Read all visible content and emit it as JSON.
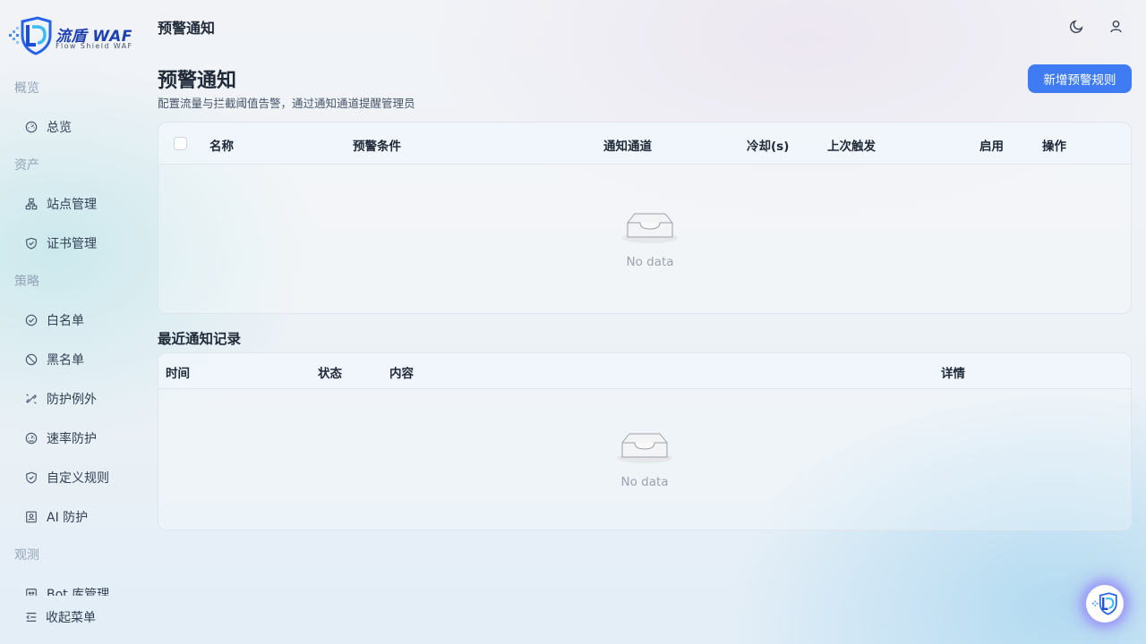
{
  "app": {
    "logo_title": "流盾 WAF",
    "logo_subtitle": "Flow Shield WAF",
    "brand_color": "#1e40af",
    "accent_color": "#3f7cf4"
  },
  "header": {
    "title": "预警通知",
    "theme_icon": "moon-icon",
    "user_icon": "user-icon"
  },
  "sidebar": {
    "groups": [
      {
        "label": "概览",
        "items": [
          {
            "label": "总览",
            "icon": "dashboard-icon"
          }
        ]
      },
      {
        "label": "资产",
        "items": [
          {
            "label": "站点管理",
            "icon": "sitemap-icon"
          },
          {
            "label": "证书管理",
            "icon": "shield-check-icon"
          }
        ]
      },
      {
        "label": "策略",
        "items": [
          {
            "label": "白名单",
            "icon": "check-circle-icon"
          },
          {
            "label": "黑名单",
            "icon": "ban-icon"
          },
          {
            "label": "防护例外",
            "icon": "unlink-icon"
          },
          {
            "label": "速率防护",
            "icon": "speedometer-icon"
          },
          {
            "label": "自定义规则",
            "icon": "shield-check-icon"
          },
          {
            "label": "AI 防护",
            "icon": "robot-icon"
          }
        ]
      },
      {
        "label": "观测",
        "items": [
          {
            "label": "Bot 库管理",
            "icon": "bot-icon"
          }
        ]
      }
    ],
    "collapse_label": "收起菜单"
  },
  "page": {
    "title": "预警通知",
    "description": "配置流量与拦截阈值告警，通过通知通道提醒管理员",
    "add_button": "新增预警规则"
  },
  "rules_table": {
    "columns": [
      "名称",
      "预警条件",
      "通知通道",
      "冷却(s)",
      "上次触发",
      "启用",
      "操作"
    ],
    "rows": [],
    "empty_text": "No data"
  },
  "records_section": {
    "title": "最近通知记录"
  },
  "records_table": {
    "columns": [
      "时间",
      "状态",
      "内容",
      "详情"
    ],
    "rows": [],
    "empty_text": "No data"
  }
}
